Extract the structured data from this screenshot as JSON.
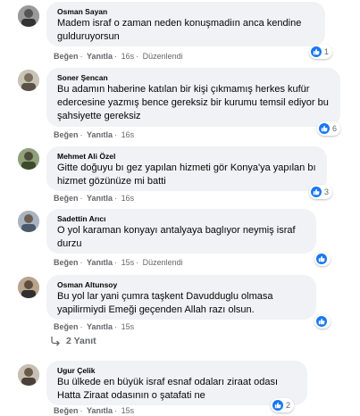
{
  "actions": {
    "like": "Beğen",
    "reply": "Yanıtla",
    "edited": "Düzenlendi"
  },
  "comments": [
    {
      "author": "Osman Sayan",
      "text": "Madem israf o zaman neden konuşmadiın anca kendine gulduruyorsun",
      "time": "16s",
      "edited": true,
      "reactions": "1"
    },
    {
      "author": "Soner Şencan",
      "text": "Bu adamın haberine katılan bir kişi çıkmamış herkes kufür edercesine yazmış bence gereksiz bir kurumu temsil ediyor bu şahsiyette gereksiz",
      "time": "16s",
      "edited": false,
      "reactions": "6"
    },
    {
      "author": "Mehmet Ali Özel",
      "text": "Gitte doğuyu bı gez yapılan hizmeti gör Konya'ya yapılan bı hizmet gözünüze mi batti",
      "time": "16s",
      "edited": false,
      "reactions": "3"
    },
    {
      "author": "Sadettin Arıcı",
      "text": "O yol karaman konyayı antalyaya baglıyor neymiş israf durzu",
      "time": "15s",
      "edited": true,
      "reactions": ""
    },
    {
      "author": "Osman Altunsoy",
      "text": "Bu yol lar yani çumra taşkent Davudduglu olmasa yapilirmiydi Emeği geçenden Allah razı olsun.",
      "time": "15s",
      "edited": false,
      "reactions": ""
    },
    {
      "author": "Ugur Çelik",
      "text": "Bu ülkede en büyük israf esnaf odaları ziraat odası Hatta Ziraat odasının o şatafati ne",
      "time": "15s",
      "edited": false,
      "reactions": "2"
    }
  ],
  "replies_link": "2 Yanıt",
  "icons": {
    "like": "thumbs-up-icon",
    "reply": "reply-arrow-icon"
  },
  "colors": {
    "like_blue": "#1877f2",
    "bubble": "#f0f2f5",
    "meta": "#65676b"
  }
}
